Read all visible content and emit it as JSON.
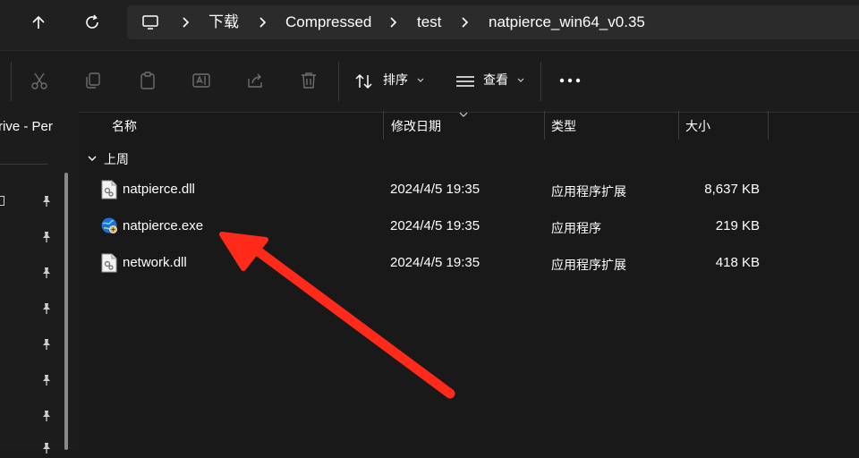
{
  "address_bar": {
    "crumbs": [
      "下载",
      "Compressed",
      "test",
      "natpierce_win64_v0.35"
    ]
  },
  "toolbar": {
    "sort_label": "排序",
    "view_label": "查看"
  },
  "sidebar": {
    "title_fragment": "rive - Per",
    "item_fragment": "□"
  },
  "columns": {
    "name": "名称",
    "date": "修改日期",
    "type": "类型",
    "size": "大小"
  },
  "group": {
    "label": "上周"
  },
  "files": [
    {
      "name": "natpierce.dll",
      "date": "2024/4/5 19:35",
      "type": "应用程序扩展",
      "size": "8,637 KB",
      "icon": "dll-file-icon"
    },
    {
      "name": "natpierce.exe",
      "date": "2024/4/5 19:35",
      "type": "应用程序",
      "size": "219 KB",
      "icon": "exe-globe-icon"
    },
    {
      "name": "network.dll",
      "date": "2024/4/5 19:35",
      "type": "应用程序扩展",
      "size": "418 KB",
      "icon": "dll-file-icon"
    }
  ],
  "colors": {
    "background": "#191919",
    "annotation_arrow": "#ff2a1a"
  }
}
